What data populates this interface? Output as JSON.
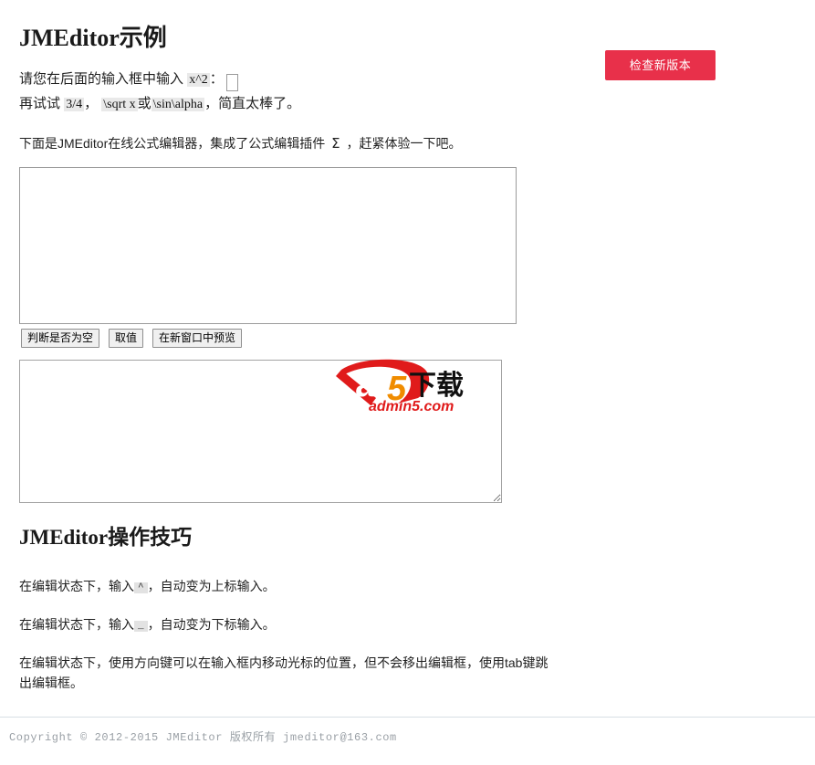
{
  "header": {
    "check_version_label": "检查新版本",
    "accent_color": "#e8304a"
  },
  "main": {
    "title": "JMEditor示例",
    "intro_prefix": "请您在后面的输入框中输入",
    "intro_code": "x^2",
    "intro_colon": "：",
    "intro_input_value": "",
    "intro_input_placeholder": "",
    "intro2_prefix": "再试试",
    "intro2_code1": "3/4",
    "intro2_comma": "，",
    "intro2_code2": "\\sqrt x",
    "intro2_or": "或",
    "intro2_code3": "\\sin\\alpha",
    "intro2_suffix": "，简直太棒了。",
    "desc_part1": "下面是JMEditor在线公式编辑器，集成了公式编辑插件",
    "desc_sigma": "Σ",
    "desc_part2": "，赶紧体验一下吧。",
    "editor_value": "",
    "editor_placeholder": "",
    "output_value": "",
    "output_placeholder": "",
    "buttons": [
      {
        "id": "check-empty",
        "label": "判断是否为空"
      },
      {
        "id": "get-value",
        "label": "取值"
      },
      {
        "id": "preview-new-window",
        "label": "在新窗口中预览"
      }
    ]
  },
  "watermark": {
    "logo_letter": "a",
    "logo_number": "5",
    "logo_cn": "下载",
    "domain": "admin5.com",
    "red": "#e01b1b",
    "orange": "#f08c00"
  },
  "tips": {
    "title": "JMEditor操作技巧",
    "items": [
      {
        "prefix": "在编辑状态下，输入",
        "code": "^",
        "suffix": "，自动变为上标输入。"
      },
      {
        "prefix": "在编辑状态下，输入",
        "code": "_",
        "suffix": "，自动变为下标输入。"
      },
      {
        "prefix": "在编辑状态下，使用方向键可以在输入框内移动光标的位置，但不会移出编辑框，使用tab键跳出编辑框。",
        "code": "",
        "suffix": ""
      }
    ]
  },
  "footer": {
    "text": "Copyright © 2012-2015 JMEditor 版权所有 jmeditor@163.com"
  }
}
